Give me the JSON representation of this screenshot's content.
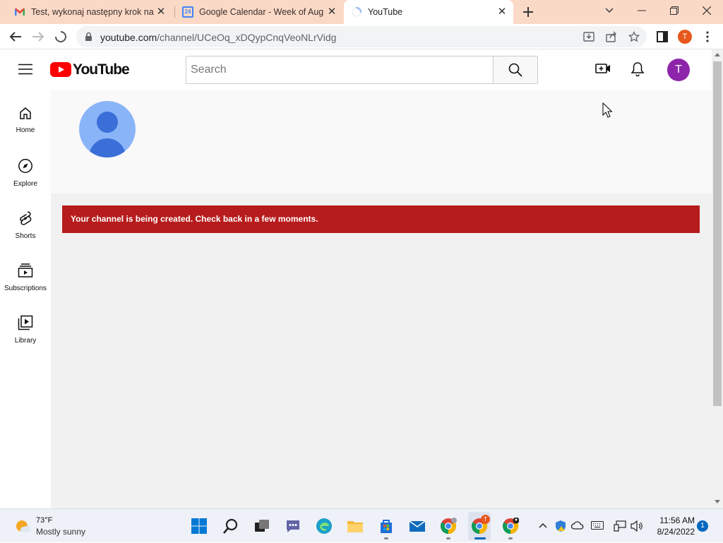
{
  "browser": {
    "tabs": [
      {
        "title": "Test, wykonaj następny krok na u",
        "favicon": "gmail-icon"
      },
      {
        "title": "Google Calendar - Week of Augu",
        "favicon": "calendar-icon",
        "favicon_text": "24"
      },
      {
        "title": "YouTube",
        "favicon": "loading-spinner-icon",
        "active": true
      }
    ],
    "url_host": "youtube.com",
    "url_path": "/channel/UCeOq_xDQypCnqVeoNLrVidg",
    "profile_initial": "T"
  },
  "youtube": {
    "logo_text": "YouTube",
    "search_placeholder": "Search",
    "avatar_initial": "T",
    "guide": [
      {
        "label": "Home",
        "icon": "home-icon"
      },
      {
        "label": "Explore",
        "icon": "compass-icon"
      },
      {
        "label": "Shorts",
        "icon": "shorts-icon"
      },
      {
        "label": "Subscriptions",
        "icon": "subscriptions-icon"
      },
      {
        "label": "Library",
        "icon": "library-icon"
      }
    ],
    "alert_message": "Your channel is being created. Check back in a few moments."
  },
  "taskbar": {
    "weather_temp": "73°F",
    "weather_desc": "Mostly sunny",
    "time": "11:56 AM",
    "date": "8/24/2022",
    "notification_count": "1",
    "chrome_badge": "T"
  },
  "colors": {
    "tabstrip": "#fbd9c7",
    "youtube_red": "#ff0000",
    "alert_red": "#b71c1c",
    "avatar_purple": "#8e24aa",
    "profile_orange": "#e8571b"
  }
}
